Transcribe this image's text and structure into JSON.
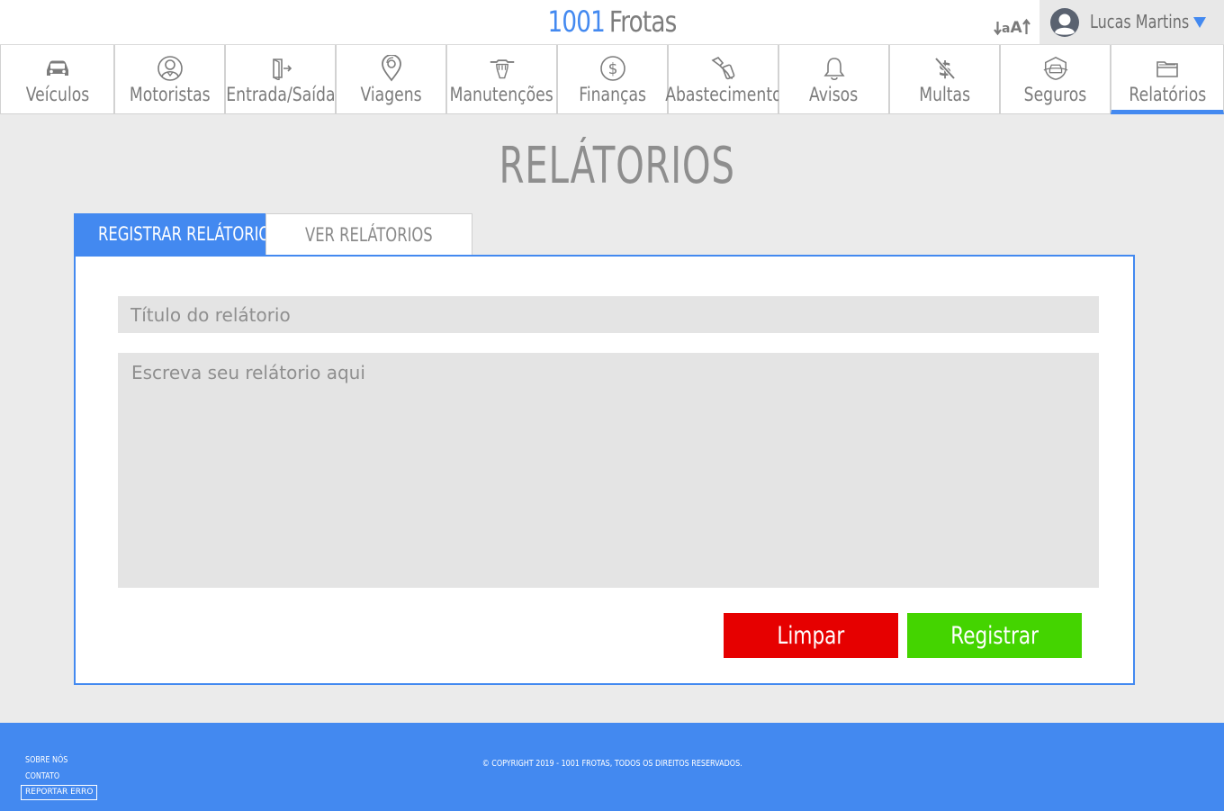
{
  "header": {
    "brand_number": "1001",
    "brand_name": "Frotas",
    "font_tool": {
      "small": "a",
      "large": "A"
    },
    "user": {
      "name": "Lucas Martins"
    }
  },
  "nav": {
    "items": [
      {
        "label": "Veículos",
        "icon": "car-icon"
      },
      {
        "label": "Motoristas",
        "icon": "driver-icon"
      },
      {
        "label": "Entrada/Saída",
        "icon": "door-exit-icon"
      },
      {
        "label": "Viagens",
        "icon": "map-pin-icon"
      },
      {
        "label": "Manutenções",
        "icon": "wrench-hand-icon"
      },
      {
        "label": "Finanças",
        "icon": "dollar-coin-icon"
      },
      {
        "label": "Abastecimento",
        "icon": "fuel-nozzle-icon"
      },
      {
        "label": "Avisos",
        "icon": "bell-icon"
      },
      {
        "label": "Multas",
        "icon": "dollar-strike-icon"
      },
      {
        "label": "Seguros",
        "icon": "insured-car-icon"
      },
      {
        "label": "Relatórios",
        "icon": "folder-icon"
      }
    ],
    "active": "Relatórios"
  },
  "page": {
    "title": "RELÁTORIOS"
  },
  "tabs": {
    "register": "REGISTRAR RELÁTORIO",
    "view": "VER RELÁTORIOS"
  },
  "form": {
    "title_placeholder": "Título do relátorio",
    "body_placeholder": "Escreva seu relátorio aqui",
    "clear_label": "Limpar",
    "register_label": "Registrar"
  },
  "footer": {
    "about": "SOBRE NÓS",
    "contact": "CONTATO",
    "report_error": "REPORTAR ERRO",
    "copyright": "© COPYRIGHT 2019 - 1001 FROTAS, TODOS OS DIREITOS RESERVADOS."
  },
  "colors": {
    "accent": "#4389f0",
    "danger": "#e60000",
    "success": "#44d400",
    "field_bg": "#e4e4e4",
    "page_bg": "#ebebeb"
  }
}
